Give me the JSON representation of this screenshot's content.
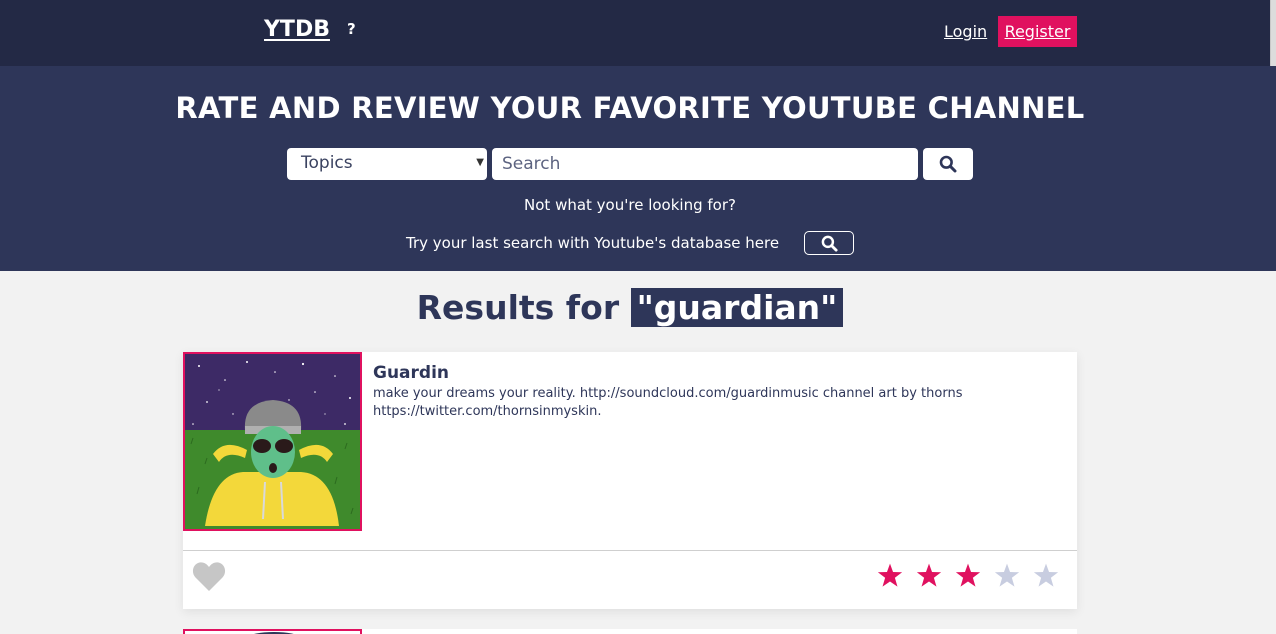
{
  "nav": {
    "brand": "YTDB",
    "help": "?",
    "login": "Login",
    "register": "Register"
  },
  "hero": {
    "title": "RATE AND REVIEW YOUR FAVORITE YOUTUBE CHANNEL",
    "topics_selected": "Topics",
    "search_placeholder": "Search",
    "hint": "Not what you're looking for?",
    "youtube_hint": "Try your last search with Youtube's database here"
  },
  "results": {
    "prefix": "Results for",
    "query": "\"guardian\"",
    "items": [
      {
        "title": "Guardin",
        "description": "make your dreams your reality. http://soundcloud.com/guardinmusic channel art by thorns https://twitter.com/thornsinmyskin.",
        "rating": 3,
        "max_rating": 5,
        "favorited": false
      }
    ]
  },
  "colors": {
    "nav_bg": "#232945",
    "hero_bg": "#2e3659",
    "accent": "#e0115f",
    "star_empty": "#c8cde0",
    "heart": "#c6c6c6"
  }
}
